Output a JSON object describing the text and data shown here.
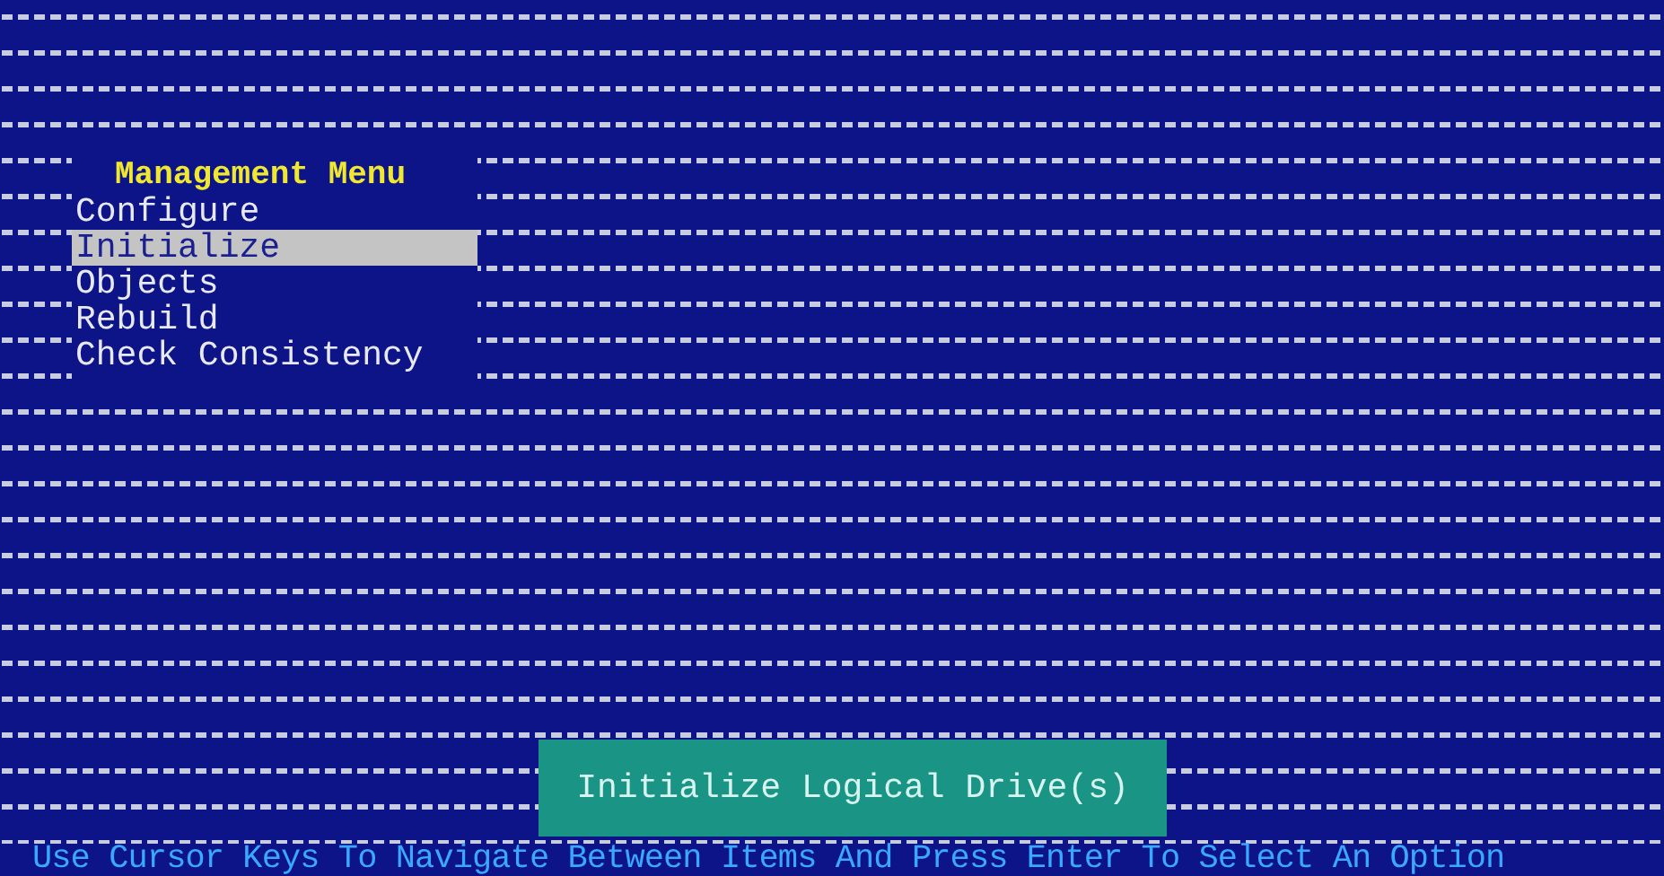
{
  "menu": {
    "title": "Management Menu",
    "items": [
      {
        "label": "Configure",
        "selected": false
      },
      {
        "label": "Initialize",
        "selected": true
      },
      {
        "label": "Objects",
        "selected": false
      },
      {
        "label": "Rebuild",
        "selected": false
      },
      {
        "label": "Check Consistency",
        "selected": false
      }
    ]
  },
  "status_panel": {
    "text": "Initialize Logical Drive(s)"
  },
  "hint_bar": {
    "text": "Use Cursor Keys To Navigate Between Items And Press Enter To Select An Option"
  }
}
